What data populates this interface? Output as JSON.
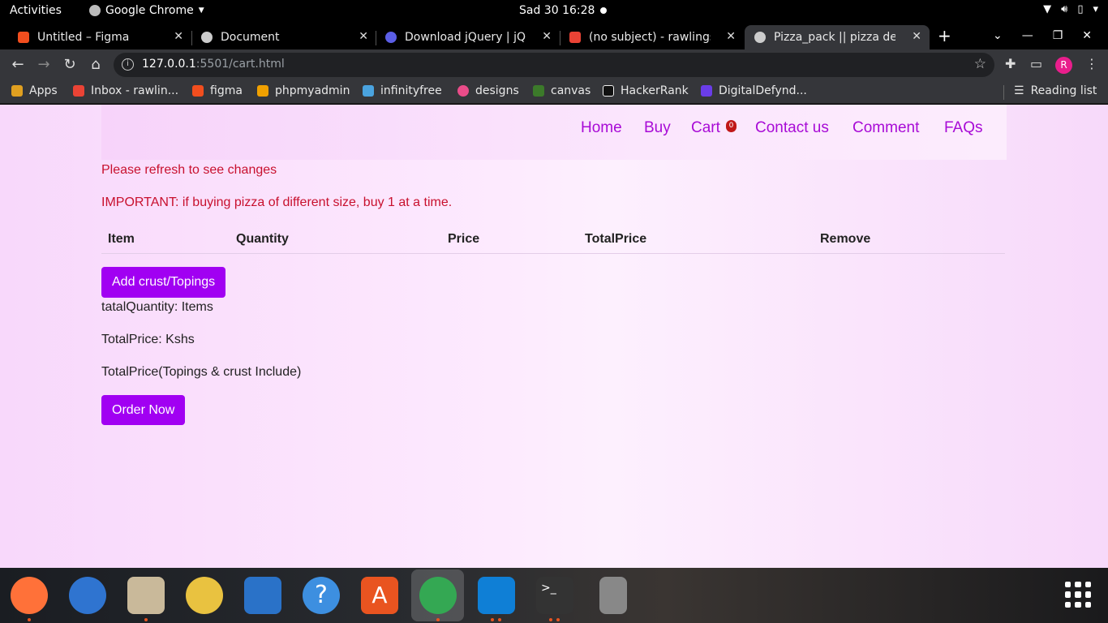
{
  "system_bar": {
    "activities": "Activities",
    "app_name": "Google Chrome",
    "clock": "Sad 30  16:28"
  },
  "tabs": [
    {
      "title": "Untitled – Figma",
      "icon": "figma-icon",
      "color": "#f24e1e"
    },
    {
      "title": "Document",
      "icon": "globe-icon",
      "color": "#cccccc"
    },
    {
      "title": "Download jQuery | jQue",
      "icon": "jquery-icon",
      "color": "#5b5ee6"
    },
    {
      "title": "(no subject) - rawlings.h",
      "icon": "gmail-icon",
      "color": "#ea4335"
    },
    {
      "title": "Pizza_pack || pizza den |",
      "icon": "globe-icon",
      "color": "#cccccc",
      "active": true
    }
  ],
  "new_tab": "+",
  "address": {
    "host": "127.0.0.1",
    "path": ":5501/cart.html"
  },
  "profile_initial": "R",
  "bookmarks": [
    {
      "label": "Apps",
      "icon": "apps-grid-icon",
      "color": "#e0a020"
    },
    {
      "label": "Inbox - rawlin...",
      "icon": "gmail-icon",
      "color": "#ea4335"
    },
    {
      "label": "figma",
      "icon": "figma-icon",
      "color": "#f24e1e"
    },
    {
      "label": "phpmyadmin",
      "icon": "phpmyadmin-icon",
      "color": "#f0a000"
    },
    {
      "label": "infinityfree",
      "icon": "infinityfree-icon",
      "color": "#4aa3df"
    },
    {
      "label": "designs",
      "icon": "dribbble-icon",
      "color": "#ea4c89"
    },
    {
      "label": "canvas",
      "icon": "palm-icon",
      "color": "#3c7a2a"
    },
    {
      "label": "HackerRank",
      "icon": "hackerrank-icon",
      "color": "#111111"
    },
    {
      "label": "DigitalDefynd...",
      "icon": "dd-icon",
      "color": "#6a3de8"
    }
  ],
  "reading_list": "Reading list",
  "site_nav": {
    "home": "Home",
    "buy": "Buy",
    "cart": "Cart",
    "cart_count": "0",
    "contact": "Contact us",
    "comment": "Comment",
    "faqs": "FAQs"
  },
  "notices": {
    "refresh": "Please refresh to see changes",
    "important": "IMPORTANT: if buying pizza of different size, buy 1 at a time."
  },
  "cart_table": {
    "headers": [
      "Item",
      "Quantity",
      "Price",
      "TotalPrice",
      "Remove"
    ]
  },
  "buttons": {
    "add_crust": "Add crust/Topings",
    "order_now": "Order Now"
  },
  "summary": {
    "total_quantity": "tatalQuantity: Items",
    "total_price": "TotalPrice: Kshs",
    "total_price_toppings": "TotalPrice(Topings & crust Include)"
  },
  "dock_apps": [
    {
      "name": "firefox-icon",
      "color": "#ff7139"
    },
    {
      "name": "thunderbird-icon",
      "color": "#2f74d0"
    },
    {
      "name": "files-icon",
      "color": "#c9b99a"
    },
    {
      "name": "rhythmbox-icon",
      "color": "#e9c240"
    },
    {
      "name": "writer-icon",
      "color": "#2a72c8"
    },
    {
      "name": "help-icon",
      "color": "#3d8fe0"
    },
    {
      "name": "software-icon",
      "color": "#e95420"
    },
    {
      "name": "chrome-icon",
      "color": "#34a853"
    },
    {
      "name": "vscode-icon",
      "color": "#0f7fd6"
    },
    {
      "name": "terminal-icon",
      "color": "#333333"
    },
    {
      "name": "disk-icon",
      "color": "#888888"
    }
  ]
}
